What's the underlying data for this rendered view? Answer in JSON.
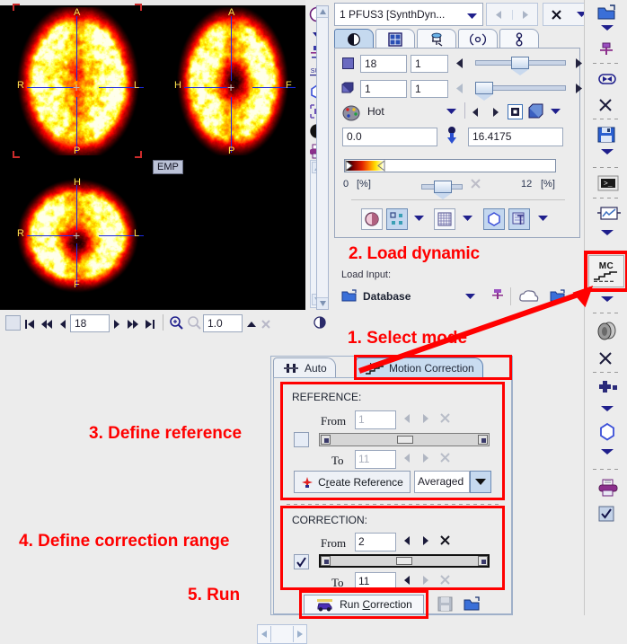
{
  "viewer": {
    "emp_label": "EMP",
    "orientation_labels": {
      "transverse": [
        "A",
        "R",
        "L",
        "P"
      ],
      "sagittal": [
        "A",
        "H",
        "F",
        "P"
      ],
      "coronal": [
        "H",
        "R",
        "L",
        "F"
      ]
    }
  },
  "slice_nav": {
    "slice_value": "18",
    "zoom_value": "1.0",
    "icons": [
      "square-button",
      "first-slice-icon",
      "prev-fast-icon",
      "prev-slice-icon",
      "next-slice-icon",
      "next-fast-icon",
      "last-slice-icon",
      "zoom-in-icon",
      "zoom-out-icon",
      "up-triangle-icon",
      "close-icon"
    ]
  },
  "left_rail": {
    "icons": [
      "info-icon",
      "chevron-down-icon",
      "anchor-icon",
      "suv-icon",
      "polygon-icon",
      "resize-icon",
      "contrast-icon",
      "printer-icon",
      "thermometer-icon",
      "crosshair-icon"
    ]
  },
  "main_panel": {
    "series": {
      "name": "1 PFUS3 [SynthDyn...",
      "prev_label": "◀",
      "next_label": "▶",
      "close_label": "✕"
    },
    "tabs": [
      {
        "icon": "contrast-icon",
        "active": true
      },
      {
        "icon": "layout-grid-icon",
        "active": false
      },
      {
        "icon": "fusion-icon",
        "active": false
      },
      {
        "icon": "radial-icon",
        "active": false
      },
      {
        "icon": "probe-icon",
        "active": false
      }
    ],
    "slice_row": {
      "value": "18",
      "step": "1"
    },
    "frame_row": {
      "value": "1",
      "step": "1"
    },
    "colortable": {
      "name": "Hot",
      "min": "0.0",
      "max": "16.4175",
      "scale_min": "0",
      "scale_min_unit": "[%]",
      "scale_max": "12",
      "scale_max_unit": "[%]"
    },
    "render_buttons": [
      "smoothing-icon",
      "markers-icon",
      "grid-icon",
      "contour-icon",
      "annotation-icon"
    ]
  },
  "load_section": {
    "title": "Load Input:",
    "source": "Database",
    "icons": [
      "folder-open-icon",
      "chevron-down-icon",
      "pin-icon",
      "cloud-icon",
      "open-file-icon"
    ]
  },
  "right_rail": {
    "icons": [
      "open-folder-icon",
      "chevron-down-icon",
      "pin-icon",
      "flip-icon",
      "scissors-icon",
      "save-icon",
      "chevron-down-icon",
      "terminal-icon",
      "chart-icon",
      "chevron-down-icon"
    ],
    "mc_button": {
      "top": "MC",
      "name": "motion-correction-icon"
    },
    "lower_icons": [
      "stack-icon",
      "close-icon",
      "add-icon",
      "chevron-down-icon",
      "polygon-icon",
      "chevron-down-icon",
      "printer-icon",
      "checkbox-icon"
    ]
  },
  "mc_dialog": {
    "tabs": [
      {
        "label": "Auto",
        "icon": "auto-icon",
        "active": false
      },
      {
        "label": "Motion Correction",
        "icon": "mc-icon",
        "active": true
      }
    ],
    "reference": {
      "title": "REFERENCE:",
      "from_label": "From",
      "from_value": "1",
      "to_label": "To",
      "to_value": "11",
      "create_button": "Create Reference",
      "mode": "Averaged",
      "checkbox_checked": false
    },
    "correction": {
      "title": "CORRECTION:",
      "from_label": "From",
      "from_value": "2",
      "to_label": "To",
      "to_value": "11",
      "checkbox_checked": true
    },
    "run_button": "Run Correction",
    "footer_icons": [
      "save-icon",
      "open-file-icon"
    ]
  },
  "annotations": [
    {
      "id": "annot-1",
      "text": "1. Select mode"
    },
    {
      "id": "annot-2",
      "text": "2. Load dynamic"
    },
    {
      "id": "annot-3",
      "text": "3. Define reference"
    },
    {
      "id": "annot-4",
      "text": "4. Define correction range"
    },
    {
      "id": "annot-5",
      "text": "5. Run"
    }
  ],
  "colors": {
    "annotation_red": "#ff0000",
    "panel_bg": "#ececec",
    "accent_blue": "#1b2ae0",
    "selected_tab": "#c5d9ef"
  }
}
